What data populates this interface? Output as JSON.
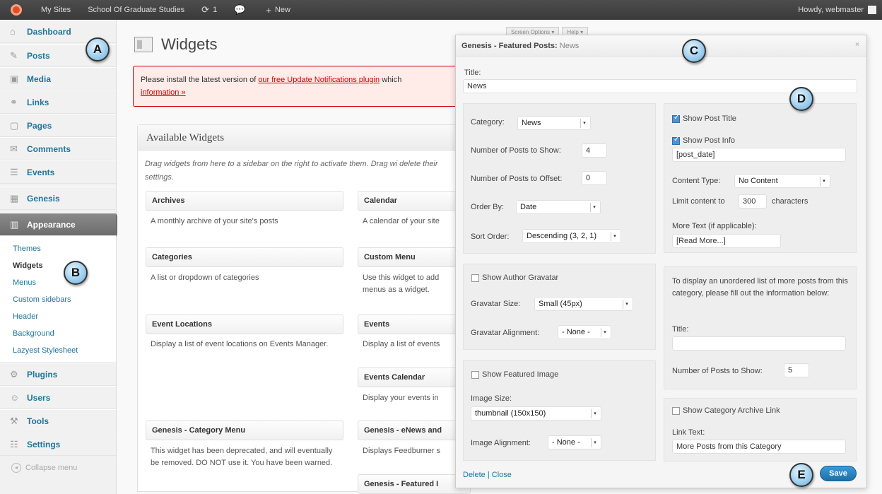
{
  "adminbar": {
    "my_sites": "My Sites",
    "site_name": "School Of Graduate Studies",
    "updates_count": "1",
    "new_label": "New",
    "howdy": "Howdy, webmaster"
  },
  "sidebar": {
    "items": [
      {
        "label": "Dashboard",
        "icon": "⌂"
      },
      {
        "label": "Posts",
        "icon": "✎"
      },
      {
        "label": "Media",
        "icon": "▣"
      },
      {
        "label": "Links",
        "icon": "⚭"
      },
      {
        "label": "Pages",
        "icon": "▢"
      },
      {
        "label": "Comments",
        "icon": "✉"
      },
      {
        "label": "Events",
        "icon": "☰"
      },
      {
        "label": "Genesis",
        "icon": "▦"
      },
      {
        "label": "Appearance",
        "icon": "▥"
      }
    ],
    "submenu": [
      "Themes",
      "Widgets",
      "Menus",
      "Custom sidebars",
      "Header",
      "Background",
      "Lazyest Stylesheet"
    ],
    "items_after": [
      {
        "label": "Plugins",
        "icon": "⚙"
      },
      {
        "label": "Users",
        "icon": "☺"
      },
      {
        "label": "Tools",
        "icon": "⚒"
      },
      {
        "label": "Settings",
        "icon": "☷"
      }
    ],
    "collapse": "Collapse menu"
  },
  "markers": {
    "a": "A",
    "b": "B",
    "c": "C",
    "d": "D",
    "e": "E"
  },
  "page": {
    "title": "Widgets",
    "notice_pre": "Please install the latest version of ",
    "notice_link": "our free Update Notifications plugin",
    "notice_post": " which",
    "notice_link2": "information »"
  },
  "tabs_behind": [
    "Screen Options ▾",
    "Help ▾"
  ],
  "available": {
    "heading": "Available Widgets",
    "desc": "Drag widgets from here to a sidebar on the right to activate them. Drag wi delete their settings.",
    "widgets": [
      {
        "title": "Archives",
        "desc": "A monthly archive of your site's posts"
      },
      {
        "title": "Calendar",
        "desc": "A calendar of your site"
      },
      {
        "title": "Categories",
        "desc": "A list or dropdown of categories"
      },
      {
        "title": "Custom Menu",
        "desc": "Use this widget to add menus as a widget."
      },
      {
        "title": "Event Locations",
        "desc": "Display a list of event locations on Events Manager."
      },
      {
        "title": "Events",
        "desc": "Display a list of events"
      },
      {
        "title": "Events Calendar",
        "desc": "Display your events in"
      },
      {
        "title": "Genesis - Category Menu",
        "desc": "This widget has been deprecated, and will eventually be removed. DO NOT use it. You have been warned."
      },
      {
        "title": "Genesis - eNews and",
        "desc": "Displays Feedburner s"
      },
      {
        "title": "Genesis - Featured I",
        "desc": ""
      }
    ]
  },
  "modal": {
    "title": "Genesis - Featured Posts:",
    "title_sub": "News",
    "close": "×",
    "title_label": "Title:",
    "title_value": "News",
    "category_label": "Category:",
    "category_value": "News",
    "num_posts_label": "Number of Posts to Show:",
    "num_posts_value": "4",
    "offset_label": "Number of Posts to Offset:",
    "offset_value": "0",
    "order_by_label": "Order By:",
    "order_by_value": "Date",
    "sort_order_label": "Sort Order:",
    "sort_order_value": "Descending (3, 2, 1)",
    "show_author_gravatar": "Show Author Gravatar",
    "gravatar_size_label": "Gravatar Size:",
    "gravatar_size_value": "Small (45px)",
    "gravatar_align_label": "Gravatar Alignment:",
    "gravatar_align_value": "- None -",
    "show_featured_image": "Show Featured Image",
    "image_size_label": "Image Size:",
    "image_size_value": "thumbnail (150x150)",
    "image_align_label": "Image Alignment:",
    "image_align_value": "- None -",
    "show_post_title": "Show Post Title",
    "show_post_info": "Show Post Info",
    "post_info_value": "[post_date]",
    "content_type_label": "Content Type:",
    "content_type_value": "No Content",
    "limit_label": "Limit content to",
    "limit_value": "300",
    "limit_unit": "characters",
    "more_text_label": "More Text (if applicable):",
    "more_text_value": "[Read More...]",
    "extra_help": "To display an unordered list of more posts from this category, please fill out the information below:",
    "extra_title_label": "Title:",
    "extra_title_value": "",
    "extra_num_label": "Number of Posts to Show:",
    "extra_num_value": "5",
    "show_cat_archive": "Show Category Archive Link",
    "link_text_label": "Link Text:",
    "link_text_value": "More Posts from this Category",
    "delete": "Delete",
    "sep": "|",
    "close_link": "Close",
    "save": "Save"
  }
}
